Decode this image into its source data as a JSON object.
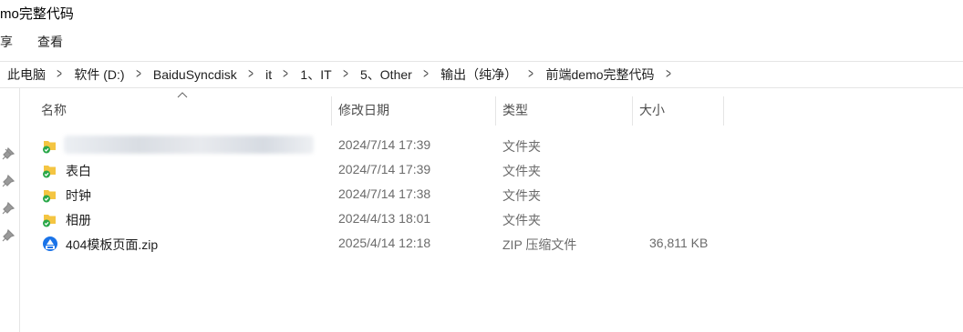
{
  "window": {
    "title": "mo完整代码"
  },
  "ribbon": {
    "tab_share": "享",
    "tab_view": "查看"
  },
  "address": {
    "crumbs": [
      "此电脑",
      "软件 (D:)",
      "BaiduSyncdisk",
      "it",
      "1、IT",
      "5、Other",
      "输出（纯净）",
      "前端demo完整代码"
    ]
  },
  "columns": {
    "name": "名称",
    "modified": "修改日期",
    "type": "类型",
    "size": "大小"
  },
  "files": [
    {
      "name": "",
      "modified": "2024/7/14 17:39",
      "type": "文件夹",
      "size": "",
      "icon": "folder-synced-icon"
    },
    {
      "name": "表白",
      "modified": "2024/7/14 17:39",
      "type": "文件夹",
      "size": "",
      "icon": "folder-synced-icon"
    },
    {
      "name": "时钟",
      "modified": "2024/7/14 17:38",
      "type": "文件夹",
      "size": "",
      "icon": "folder-synced-icon"
    },
    {
      "name": "相册",
      "modified": "2024/4/13 18:01",
      "type": "文件夹",
      "size": "",
      "icon": "folder-synced-icon"
    },
    {
      "name": "404模板页面.zip",
      "modified": "2025/4/14 12:18",
      "type": "ZIP 压缩文件",
      "size": "36,811 KB",
      "icon": "zip-file-icon"
    }
  ],
  "colors": {
    "folder": "#f4c542",
    "sync_check": "#2aa84a",
    "zip_blue": "#1a73e8"
  }
}
